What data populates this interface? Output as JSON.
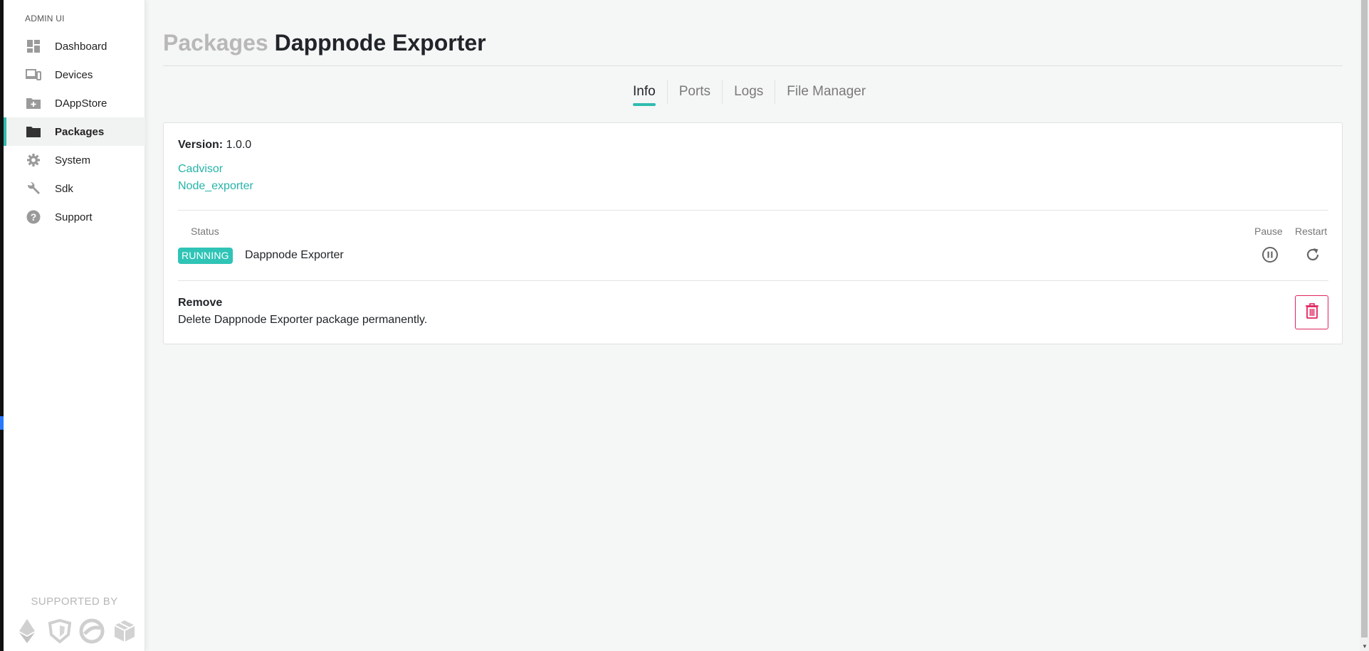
{
  "sidebar": {
    "title": "ADMIN UI",
    "items": [
      {
        "label": "Dashboard",
        "icon": "dashboard-icon",
        "active": false
      },
      {
        "label": "Devices",
        "icon": "devices-icon",
        "active": false
      },
      {
        "label": "DAppStore",
        "icon": "folder-plus-icon",
        "active": false
      },
      {
        "label": "Packages",
        "icon": "folder-icon",
        "active": true
      },
      {
        "label": "System",
        "icon": "gear-icon",
        "active": false
      },
      {
        "label": "Sdk",
        "icon": "wrench-icon",
        "active": false
      },
      {
        "label": "Support",
        "icon": "help-icon",
        "active": false
      }
    ],
    "supported_by": "SUPPORTED BY",
    "sponsor_icons": [
      "ethereum-icon",
      "shield-logo-icon",
      "swirl-logo-icon",
      "cubes-logo-icon"
    ]
  },
  "header": {
    "breadcrumb": "Packages",
    "title": "Dappnode Exporter"
  },
  "tabs": [
    {
      "label": "Info",
      "active": true
    },
    {
      "label": "Ports",
      "active": false
    },
    {
      "label": "Logs",
      "active": false
    },
    {
      "label": "File Manager",
      "active": false
    }
  ],
  "info": {
    "version_label": "Version:",
    "version_value": "1.0.0",
    "links": [
      "Cadvisor",
      "Node_exporter"
    ],
    "status_header": "Status",
    "pause_header": "Pause",
    "restart_header": "Restart",
    "container": {
      "state": "RUNNING",
      "name": "Dappnode Exporter"
    },
    "remove_title": "Remove",
    "remove_desc": "Delete Dappnode Exporter package permanently."
  },
  "colors": {
    "accent": "#2fbcb0",
    "running_badge": "#2fc4b6",
    "danger": "#e0245e",
    "link": "#26b3a8"
  }
}
